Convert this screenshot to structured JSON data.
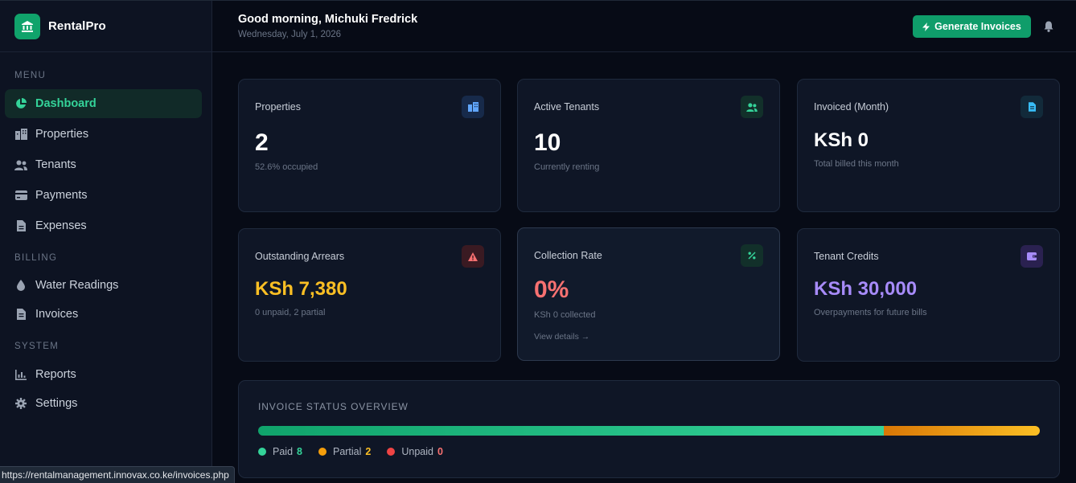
{
  "app": {
    "name": "RentalPro",
    "brand_color": "#10a36b"
  },
  "sidebar": {
    "sections": {
      "menu": "MENU",
      "billing": "BILLING",
      "system": "SYSTEM"
    },
    "items": [
      {
        "label": "Dashboard",
        "icon": "pie-chart-icon",
        "active": true
      },
      {
        "label": "Properties",
        "icon": "building-icon"
      },
      {
        "label": "Tenants",
        "icon": "users-icon"
      },
      {
        "label": "Payments",
        "icon": "credit-card-icon"
      },
      {
        "label": "Expenses",
        "icon": "file-icon"
      },
      {
        "label": "Water Readings",
        "icon": "droplet-icon"
      },
      {
        "label": "Invoices",
        "icon": "document-icon"
      },
      {
        "label": "Reports",
        "icon": "bar-chart-icon"
      },
      {
        "label": "Settings",
        "icon": "gear-icon"
      }
    ]
  },
  "header": {
    "greeting": "Good morning, Michuki Fredrick",
    "date": "Wednesday, July 1, 2026",
    "generate_label": "Generate Invoices"
  },
  "cards": [
    {
      "title": "Properties",
      "value": "2",
      "sub": "52.6% occupied",
      "icon": "building-icon",
      "value_color": "#ffffff"
    },
    {
      "title": "Active Tenants",
      "value": "10",
      "sub": "Currently renting",
      "icon": "users-icon",
      "value_color": "#ffffff"
    },
    {
      "title": "Invoiced (Month)",
      "value": "KSh 0",
      "sub": "Total billed this month",
      "icon": "document-icon",
      "value_color": "#ffffff"
    },
    {
      "title": "Outstanding Arrears",
      "value": "KSh 7,380",
      "sub": "0 unpaid, 2 partial",
      "icon": "warning-icon",
      "value_color": "#fbbf24"
    },
    {
      "title": "Collection Rate",
      "value": "0%",
      "sub": "KSh 0 collected",
      "link": "View details →",
      "icon": "percent-icon",
      "value_color": "#f87171"
    },
    {
      "title": "Tenant Credits",
      "value": "KSh 30,000",
      "sub": "Overpayments for future bills",
      "icon": "wallet-icon",
      "value_color": "#a78bfa"
    }
  ],
  "overview": {
    "title": "INVOICE STATUS OVERVIEW",
    "legend": [
      {
        "label": "Paid",
        "count": 8,
        "color": "#34d399"
      },
      {
        "label": "Partial",
        "count": 2,
        "color": "#fbbf24"
      },
      {
        "label": "Unpaid",
        "count": 0,
        "color": "#ef4444"
      }
    ]
  },
  "statusbar": {
    "url": "https://rentalmanagement.innovax.co.ke/invoices.php"
  }
}
